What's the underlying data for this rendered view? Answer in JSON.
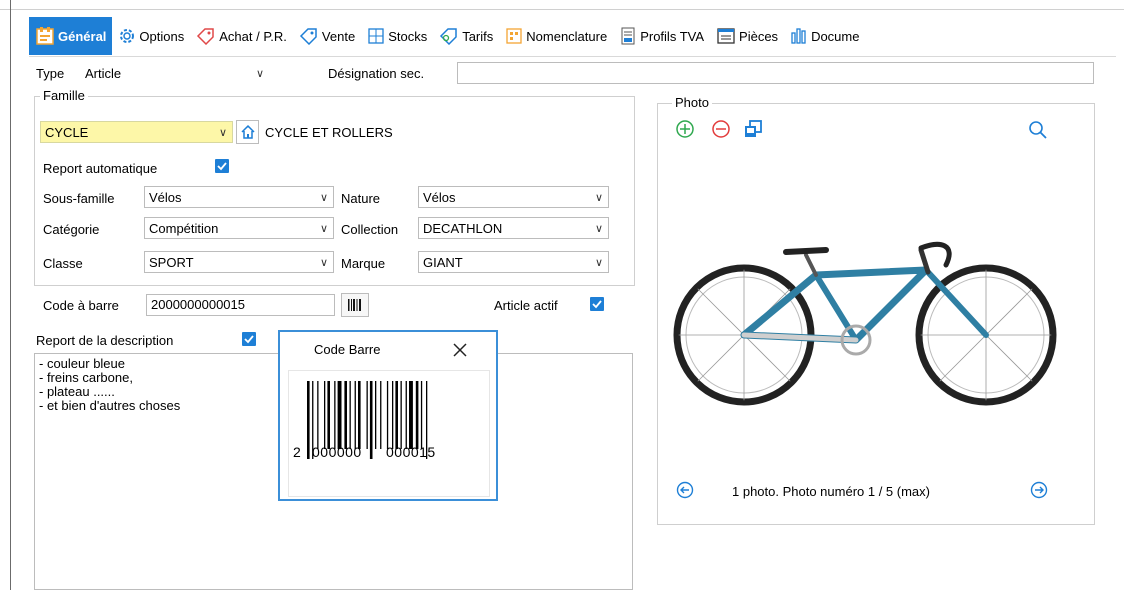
{
  "tabs": [
    {
      "label": "Général",
      "icon": "general-icon"
    },
    {
      "label": "Options",
      "icon": "gear-icon"
    },
    {
      "label": "Achat / P.R.",
      "icon": "purchase-tag-icon"
    },
    {
      "label": "Vente",
      "icon": "sale-tag-icon"
    },
    {
      "label": "Stocks",
      "icon": "stocks-icon"
    },
    {
      "label": "Tarifs",
      "icon": "tariffs-tag-icon"
    },
    {
      "label": "Nomenclature",
      "icon": "nomenclature-icon"
    },
    {
      "label": "Profils TVA",
      "icon": "tva-icon"
    },
    {
      "label": "Pièces",
      "icon": "documents-icon"
    },
    {
      "label": "Docume",
      "icon": "bar-chart-icon"
    }
  ],
  "form": {
    "type_label": "Type",
    "type_value": "Article",
    "designation_label": "Désignation sec.",
    "designation_value": "",
    "famille_title": "Famille",
    "famille_code": "CYCLE",
    "famille_name": "CYCLE ET ROLLERS",
    "report_auto_label": "Report automatique",
    "sous_famille_label": "Sous-famille",
    "sous_famille_value": "Vélos",
    "nature_label": "Nature",
    "nature_value": "Vélos",
    "categorie_label": "Catégorie",
    "categorie_value": "Compétition",
    "collection_label": "Collection",
    "collection_value": "DECATHLON",
    "classe_label": "Classe",
    "classe_value": "SPORT",
    "marque_label": "Marque",
    "marque_value": "GIANT",
    "code_barre_label": "Code à barre",
    "code_barre_value": "2000000000015",
    "article_actif_label": "Article actif",
    "report_desc_label": "Report de la description",
    "description_lines": [
      "- couleur bleue",
      "- freins carbone,",
      "- plateau ......",
      "- et bien d'autres choses"
    ]
  },
  "photo": {
    "title": "Photo",
    "status": "1 photo. Photo numéro 1 / 5 (max)"
  },
  "popup": {
    "title": "Code Barre",
    "barcode_digits_first": "2",
    "barcode_digits_left": "000000",
    "barcode_digits_right": "000015"
  },
  "colors": {
    "accent": "#1e7fd6",
    "highlight_field": "#fdf7a8",
    "add_icon": "#2fa84f",
    "remove_icon": "#e23b3b"
  }
}
